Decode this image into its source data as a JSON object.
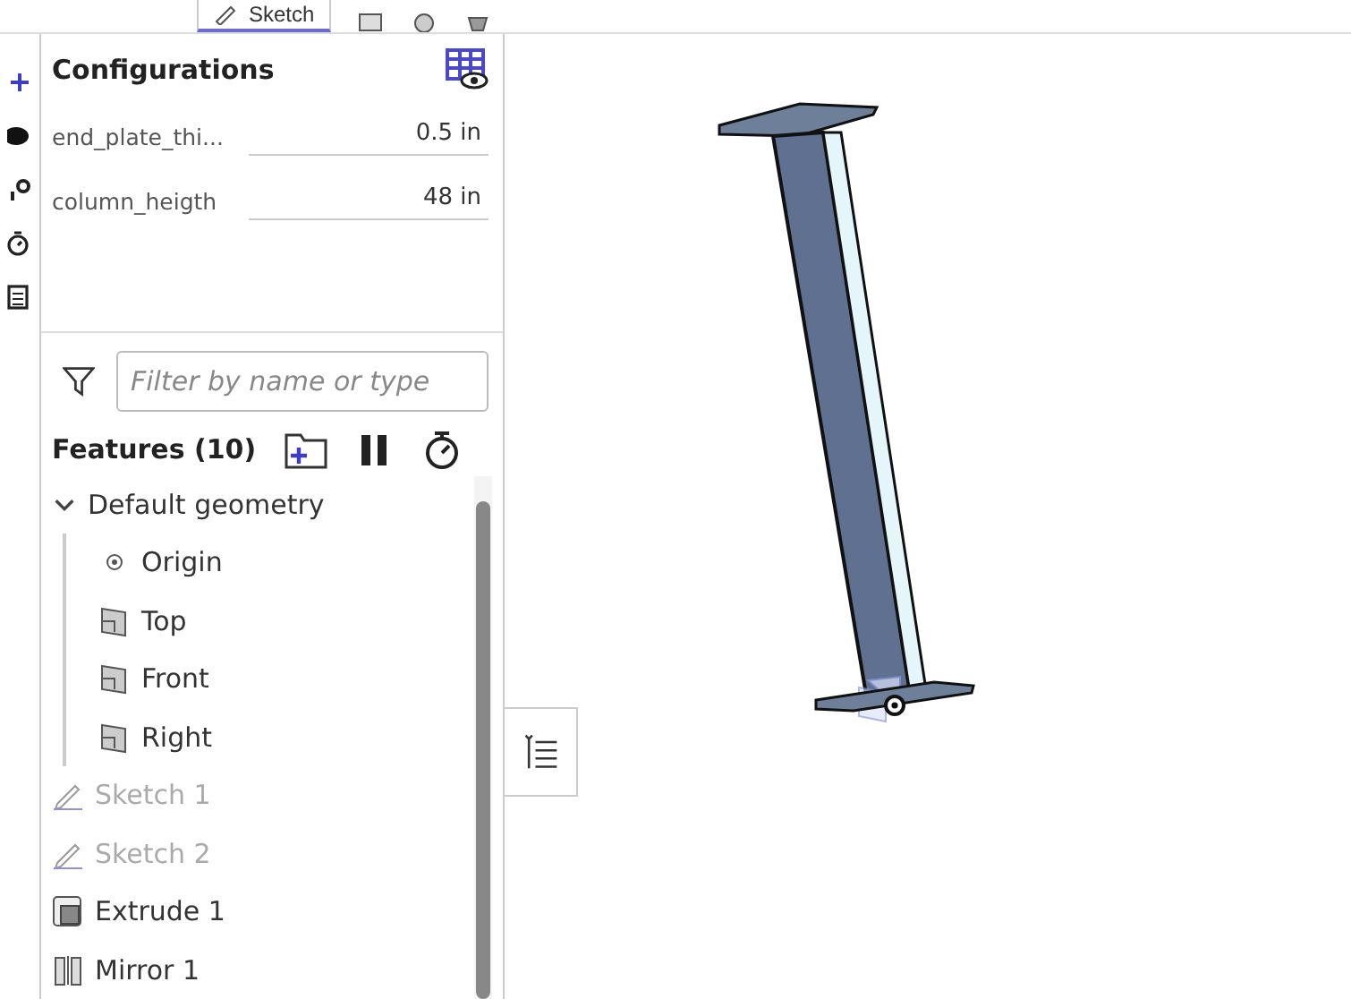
{
  "toolbar": {
    "tabs": [
      {
        "label": "Sketch",
        "selected": true
      }
    ]
  },
  "configurations": {
    "title": "Configurations",
    "params": [
      {
        "name": "end_plate_thi...",
        "value": "0.5 in"
      },
      {
        "name": "column_heigth",
        "value": "48 in"
      }
    ]
  },
  "filter": {
    "placeholder": "Filter by name or type"
  },
  "features": {
    "title": "Features (10)",
    "items": [
      {
        "label": "Default geometry",
        "kind": "group",
        "expanded": true,
        "hidden": false,
        "children": [
          {
            "label": "Origin",
            "kind": "origin",
            "hidden": false
          },
          {
            "label": "Top",
            "kind": "plane",
            "hidden": false
          },
          {
            "label": "Front",
            "kind": "plane",
            "hidden": false
          },
          {
            "label": "Right",
            "kind": "plane",
            "hidden": false
          }
        ]
      },
      {
        "label": "Sketch 1",
        "kind": "sketch",
        "hidden": true
      },
      {
        "label": "Sketch 2",
        "kind": "sketch",
        "hidden": true
      },
      {
        "label": "Extrude 1",
        "kind": "extrude",
        "hidden": false
      },
      {
        "label": "Mirror 1",
        "kind": "mirror",
        "hidden": false
      }
    ]
  }
}
